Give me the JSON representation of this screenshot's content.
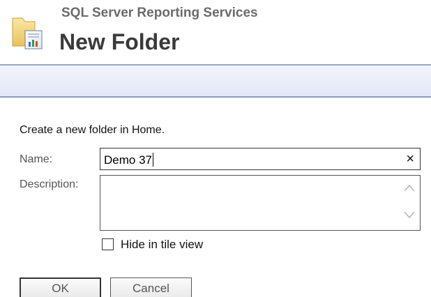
{
  "header": {
    "app_name": "SQL Server Reporting Services",
    "title": "New Folder",
    "icon": "folder-report-icon"
  },
  "form": {
    "intro": "Create a new folder in Home.",
    "name_label": "Name:",
    "name_value": "Demo 37",
    "clear_icon": "×",
    "description_label": "Description:",
    "description_value": "",
    "hide_in_tile_label": "Hide in tile view",
    "hide_in_tile_checked": false
  },
  "buttons": {
    "ok_label": "OK",
    "cancel_label": "Cancel"
  }
}
